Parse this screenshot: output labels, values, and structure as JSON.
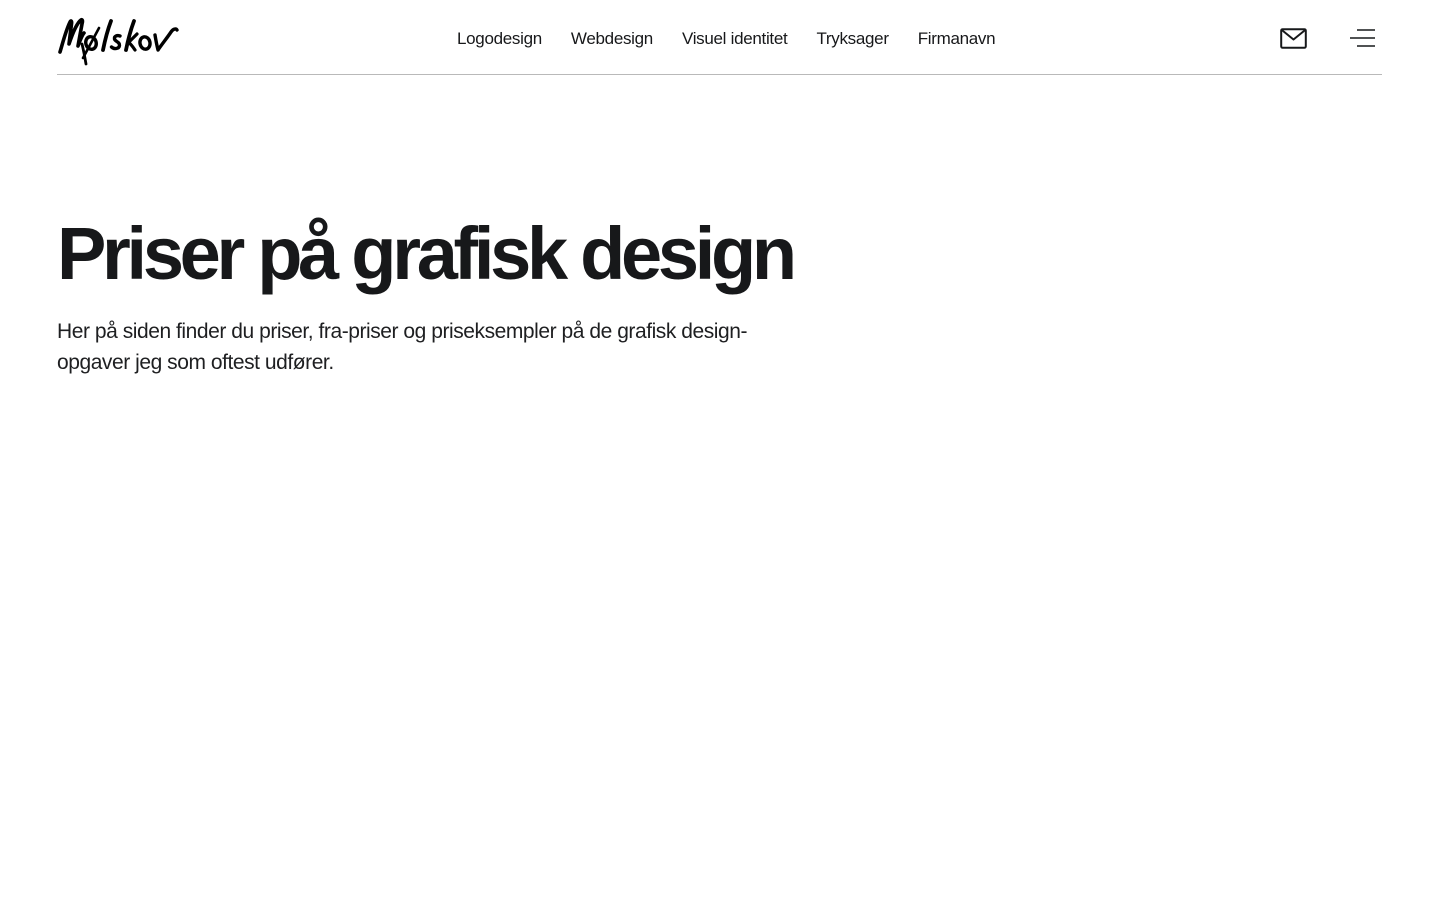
{
  "header": {
    "logo_text": "Mølskov",
    "nav": [
      {
        "label": "Logodesign"
      },
      {
        "label": "Webdesign"
      },
      {
        "label": "Visuel identitet"
      },
      {
        "label": "Tryksager"
      },
      {
        "label": "Firmanavn"
      }
    ],
    "icons": {
      "mail": "envelope-icon",
      "menu": "hamburger-menu-icon"
    }
  },
  "hero": {
    "title": "Priser på grafisk design",
    "intro": "Her på siden finder du priser, fra-priser og priseksempler på de grafisk design-opgaver jeg som oftest udfører."
  },
  "colors": {
    "text": "#17181a",
    "background": "#ffffff",
    "divider": "#b9b9b9"
  }
}
